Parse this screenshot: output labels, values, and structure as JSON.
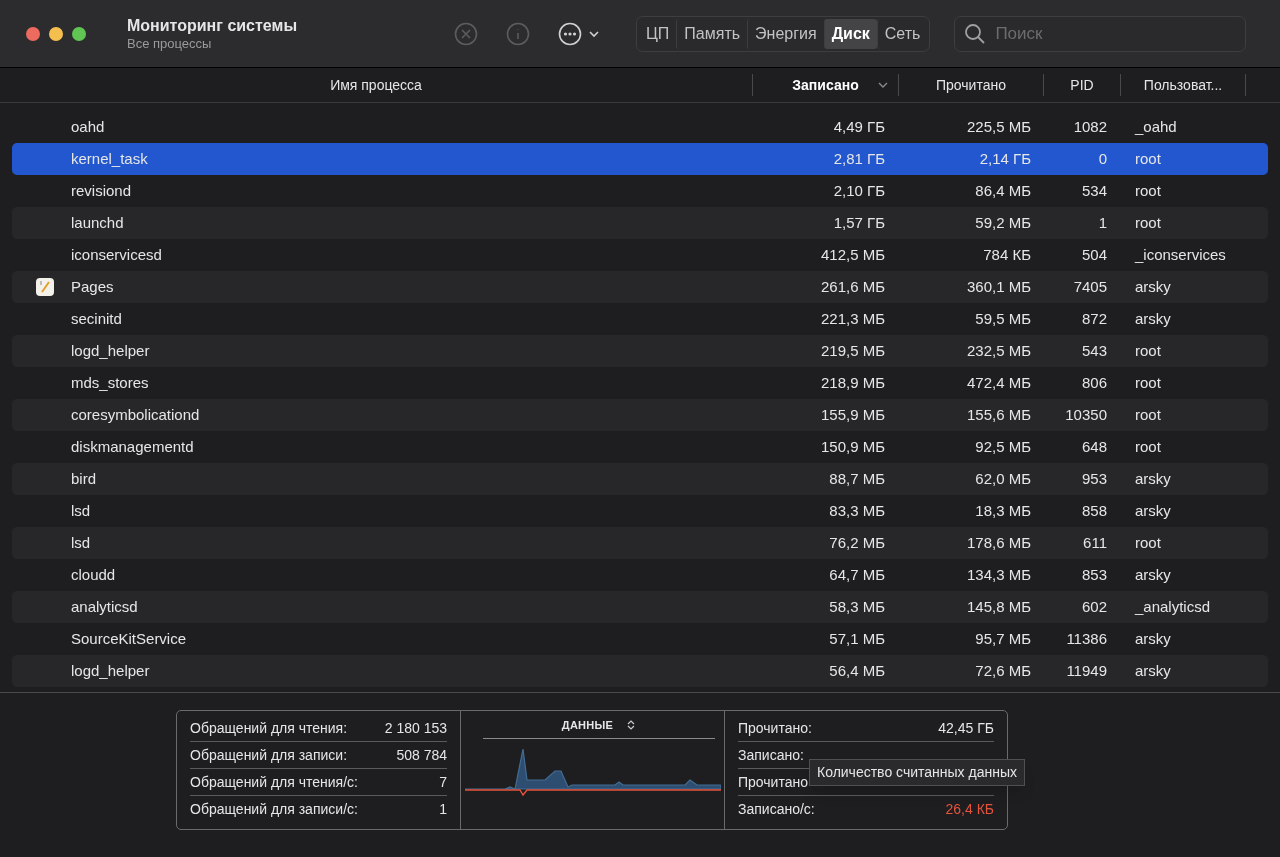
{
  "window": {
    "title": "Мониторинг системы",
    "subtitle": "Все процессы"
  },
  "toolbar": {
    "stop_disabled": true,
    "info_disabled": true
  },
  "tabs": [
    {
      "label": "ЦП",
      "selected": false
    },
    {
      "label": "Память",
      "selected": false
    },
    {
      "label": "Энергия",
      "selected": false
    },
    {
      "label": "Диск",
      "selected": true
    },
    {
      "label": "Сеть",
      "selected": false
    }
  ],
  "search": {
    "placeholder": "Поиск"
  },
  "table": {
    "columns": [
      {
        "label": "Имя процесса",
        "sorted": false
      },
      {
        "label": "Записано",
        "sorted": true
      },
      {
        "label": "Прочитано",
        "sorted": false
      },
      {
        "label": "PID",
        "sorted": false
      },
      {
        "label": "Пользоват...",
        "sorted": false
      }
    ],
    "rows": [
      {
        "name": "oahd",
        "written": "4,49 ГБ",
        "read": "225,5 МБ",
        "pid": "1082",
        "user": "_oahd",
        "selected": false
      },
      {
        "name": "kernel_task",
        "written": "2,81 ГБ",
        "read": "2,14 ГБ",
        "pid": "0",
        "user": "root",
        "selected": true
      },
      {
        "name": "revisiond",
        "written": "2,10 ГБ",
        "read": "86,4 МБ",
        "pid": "534",
        "user": "root",
        "selected": false
      },
      {
        "name": "launchd",
        "written": "1,57 ГБ",
        "read": "59,2 МБ",
        "pid": "1",
        "user": "root",
        "selected": false
      },
      {
        "name": "iconservicesd",
        "written": "412,5 МБ",
        "read": "784 КБ",
        "pid": "504",
        "user": "_iconservices",
        "selected": false
      },
      {
        "name": "Pages",
        "written": "261,6 МБ",
        "read": "360,1 МБ",
        "pid": "7405",
        "user": "arsky",
        "selected": false,
        "kind": "app"
      },
      {
        "name": "secinitd",
        "written": "221,3 МБ",
        "read": "59,5 МБ",
        "pid": "872",
        "user": "arsky",
        "selected": false
      },
      {
        "name": "logd_helper",
        "written": "219,5 МБ",
        "read": "232,5 МБ",
        "pid": "543",
        "user": "root",
        "selected": false
      },
      {
        "name": "mds_stores",
        "written": "218,9 МБ",
        "read": "472,4 МБ",
        "pid": "806",
        "user": "root",
        "selected": false
      },
      {
        "name": "coresymbolicationd",
        "written": "155,9 МБ",
        "read": "155,6 МБ",
        "pid": "10350",
        "user": "root",
        "selected": false
      },
      {
        "name": "diskmanagementd",
        "written": "150,9 МБ",
        "read": "92,5 МБ",
        "pid": "648",
        "user": "root",
        "selected": false
      },
      {
        "name": "bird",
        "written": "88,7 МБ",
        "read": "62,0 МБ",
        "pid": "953",
        "user": "arsky",
        "selected": false
      },
      {
        "name": "lsd",
        "written": "83,3 МБ",
        "read": "18,3 МБ",
        "pid": "858",
        "user": "arsky",
        "selected": false
      },
      {
        "name": "lsd",
        "written": "76,2 МБ",
        "read": "178,6 МБ",
        "pid": "611",
        "user": "root",
        "selected": false
      },
      {
        "name": "cloudd",
        "written": "64,7 МБ",
        "read": "134,3 МБ",
        "pid": "853",
        "user": "arsky",
        "selected": false
      },
      {
        "name": "analyticsd",
        "written": "58,3 МБ",
        "read": "145,8 МБ",
        "pid": "602",
        "user": "_analyticsd",
        "selected": false
      },
      {
        "name": "SourceKitService",
        "written": "57,1 МБ",
        "read": "95,7 МБ",
        "pid": "11386",
        "user": "arsky",
        "selected": false
      },
      {
        "name": "logd_helper",
        "written": "56,4 МБ",
        "read": "72,6 МБ",
        "pid": "11949",
        "user": "arsky",
        "selected": false
      }
    ]
  },
  "summary": {
    "left": [
      {
        "label": "Обращений для чтения:",
        "value": "2 180 153"
      },
      {
        "label": "Обращений для записи:",
        "value": "508 784"
      },
      {
        "label": "Обращений для чтения/с:",
        "value": "7"
      },
      {
        "label": "Обращений для записи/с:",
        "value": "1"
      }
    ],
    "chart_title": "ДАННЫЕ",
    "right": [
      {
        "label": "Прочитано:",
        "value": "42,45 ГБ"
      },
      {
        "label": "Записано:"
      },
      {
        "label": "Прочитано"
      },
      {
        "label": "Записано/с:",
        "value": "26,4 КБ",
        "color": "#e5533d"
      }
    ],
    "tooltip": "Количество считанных данных"
  }
}
